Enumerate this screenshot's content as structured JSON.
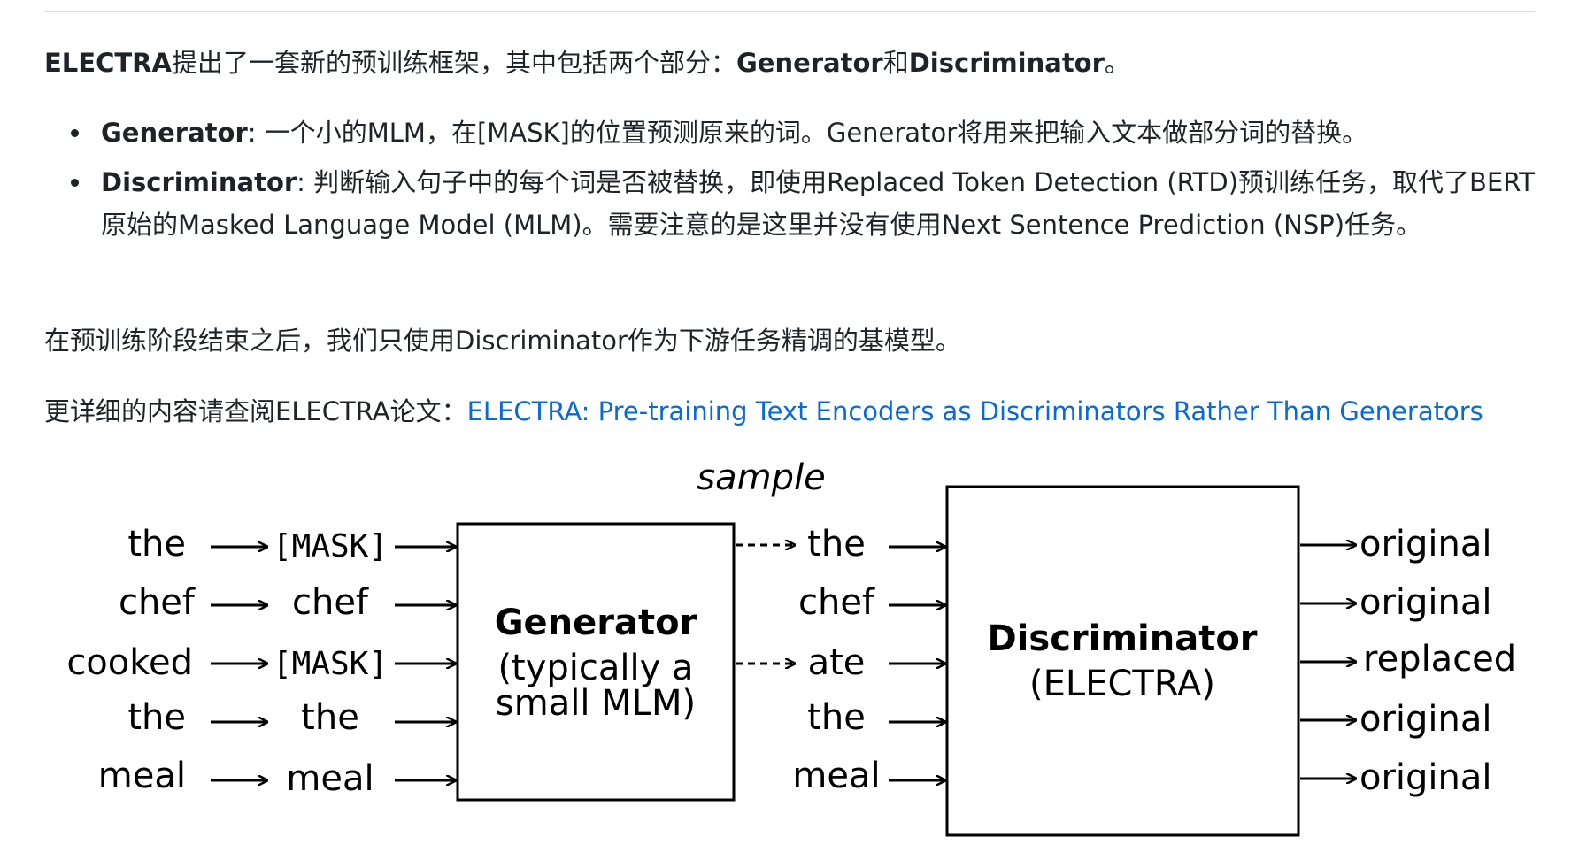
{
  "intro": {
    "part1": "ELECTRA",
    "part2": "提出了一套新的预训练框架，其中包括两个部分：",
    "part3": "Generator",
    "part4": "和",
    "part5": "Discriminator",
    "part6": "。"
  },
  "bullets": [
    {
      "term": "Generator",
      "text": ": 一个小的MLM，在[MASK]的位置预测原来的词。Generator将用来把输入文本做部分词的替换。"
    },
    {
      "term": "Discriminator",
      "text": ": 判断输入句子中的每个词是否被替换，即使用Replaced Token Detection (RTD)预训练任务，取代了BERT原始的Masked Language Model (MLM)。需要注意的是这里并没有使用Next Sentence Prediction (NSP)任务。"
    }
  ],
  "finetune_text": "在预训练阶段结束之后，我们只使用Discriminator作为下游任务精调的基模型。",
  "more": {
    "prefix": "更详细的内容请查阅ELECTRA论文：",
    "link": "ELECTRA: Pre-training Text Encoders as Discriminators Rather Than Generators"
  },
  "diagram": {
    "sample_label": "sample",
    "inputs": [
      "the",
      "chef",
      "cooked",
      "the",
      "meal"
    ],
    "masked": [
      "[MASK]",
      "chef",
      "[MASK]",
      "the",
      "meal"
    ],
    "generator_title": "Generator",
    "generator_sub1": "(typically a",
    "generator_sub2": "small MLM)",
    "sampled": [
      "the",
      "chef",
      "ate",
      "the",
      "meal"
    ],
    "discriminator_title": "Discriminator",
    "discriminator_sub": "(ELECTRA)",
    "outputs": [
      "original",
      "original",
      "replaced",
      "original",
      "original"
    ]
  },
  "colors": {
    "link": "#0969da",
    "text": "#1f2328"
  }
}
